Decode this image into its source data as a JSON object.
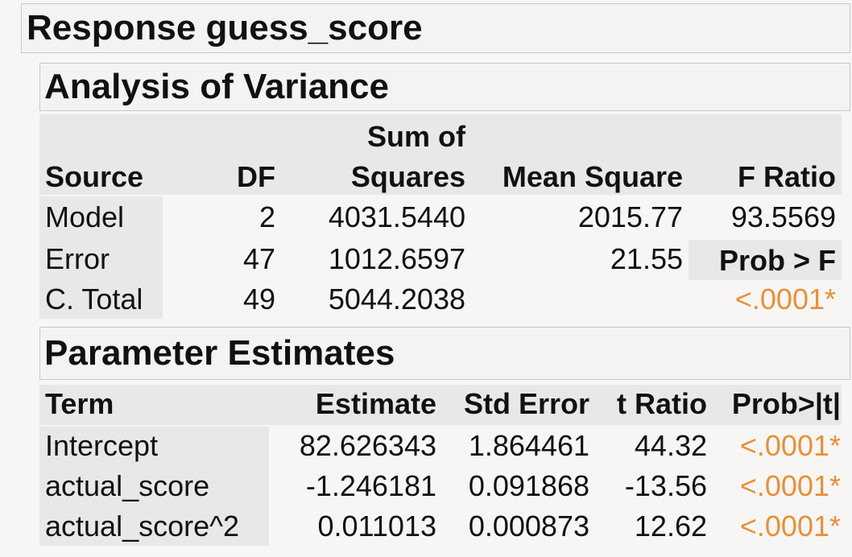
{
  "response_title": "Response guess_score",
  "anova": {
    "title": "Analysis of Variance",
    "headers": {
      "source": "Source",
      "df": "DF",
      "ss_top": "Sum of",
      "ss_bottom": "Squares",
      "ms": "Mean Square",
      "f": "F Ratio"
    },
    "rows": [
      {
        "source": "Model",
        "df": "2",
        "ss": "4031.5440",
        "ms": "2015.77",
        "f": "93.5569"
      },
      {
        "source": "Error",
        "df": "47",
        "ss": "1012.6597",
        "ms": "21.55",
        "f": "Prob > F"
      },
      {
        "source": "C. Total",
        "df": "49",
        "ss": "5044.2038",
        "ms": "",
        "f": "<.0001*"
      }
    ],
    "colors": {
      "significant": "#e8903a"
    }
  },
  "params": {
    "title": "Parameter Estimates",
    "headers": {
      "term": "Term",
      "estimate": "Estimate",
      "stderr": "Std Error",
      "tratio": "t Ratio",
      "prob": "Prob>|t|"
    },
    "rows": [
      {
        "term": "Intercept",
        "estimate": "82.626343",
        "stderr": "1.864461",
        "tratio": "44.32",
        "prob": "<.0001*"
      },
      {
        "term": "actual_score",
        "estimate": "-1.246181",
        "stderr": "0.091868",
        "tratio": "-13.56",
        "prob": "<.0001*"
      },
      {
        "term": "actual_score^2",
        "estimate": "0.011013",
        "stderr": "0.000873",
        "tratio": "12.62",
        "prob": "<.0001*"
      }
    ]
  }
}
